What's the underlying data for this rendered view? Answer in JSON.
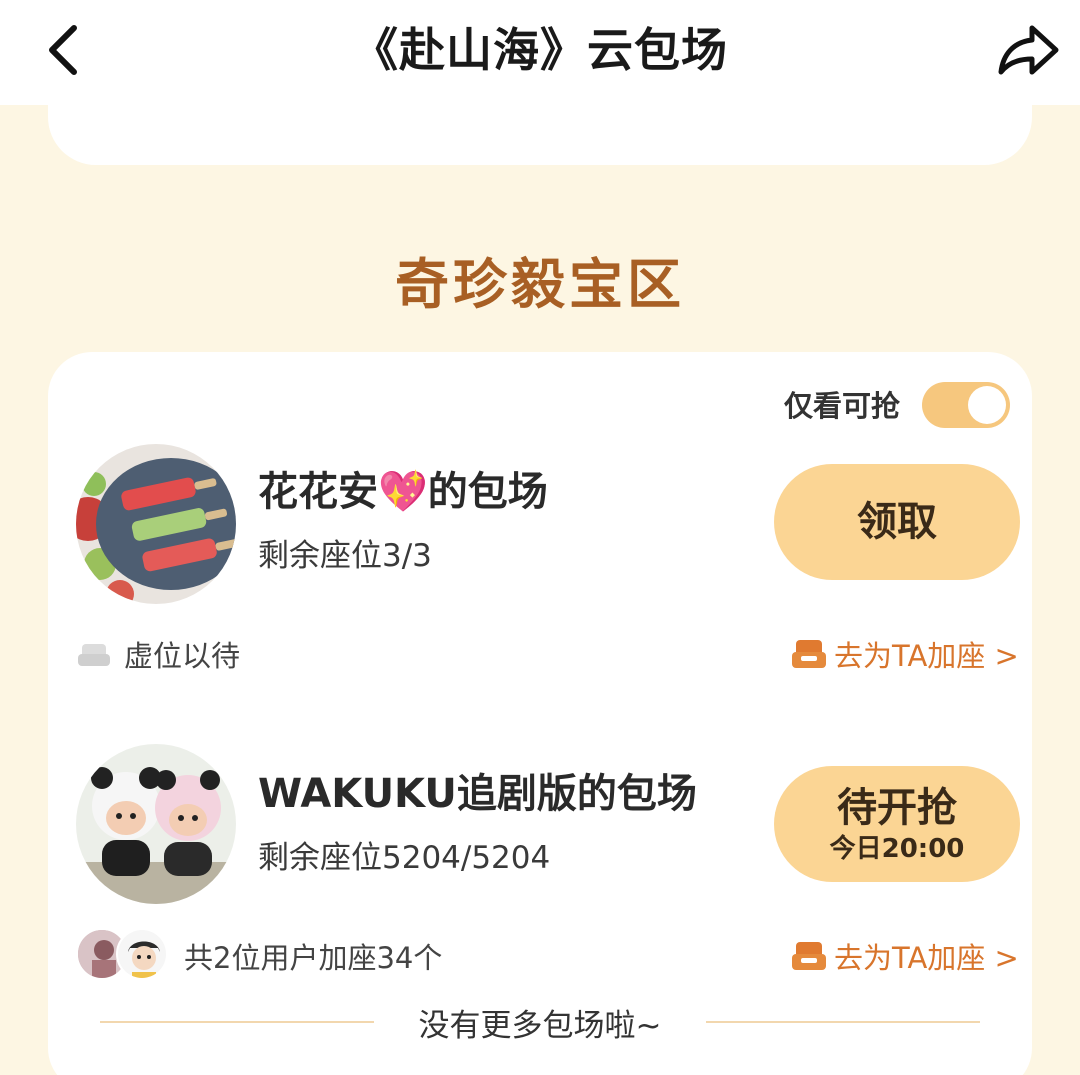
{
  "header": {
    "title": "《赴山海》云包场",
    "back_icon": "chevron-left-icon",
    "share_icon": "share-arrow-icon"
  },
  "section": {
    "title": "奇珍毅宝区",
    "filter_label": "仅看可抢",
    "filter_toggle_on": true
  },
  "rows": [
    {
      "title": "花花安💖的包场",
      "seats": "剩余座位3/3",
      "button_main": "领取",
      "button_sub": "",
      "meta_left": "虚位以待",
      "meta_right": "去为TA加座 >"
    },
    {
      "title": "WAKUKU追剧版的包场",
      "seats": "剩余座位5204/5204",
      "button_main": "待开抢",
      "button_sub": "今日20:00",
      "meta_left": "共2位用户加座34个",
      "meta_right": "去为TA加座 >"
    }
  ],
  "footer": {
    "note": "没有更多包场啦~"
  },
  "colors": {
    "background": "#fdf6e3",
    "accent_title": "#a85f24",
    "button_fill": "#fbd594",
    "link_orange": "#d8752c",
    "toggle_on": "#f6c77e"
  }
}
